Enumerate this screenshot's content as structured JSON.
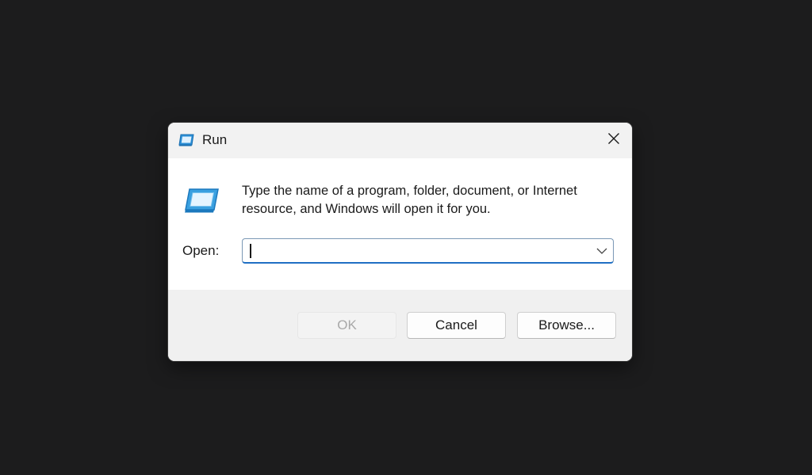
{
  "dialog": {
    "title": "Run",
    "title_icon": "run-app-icon",
    "close_icon": "close-icon"
  },
  "content": {
    "icon": "run-app-icon",
    "message": "Type the name of a program, folder, document, or Internet resource, and Windows will open it for you.",
    "open_label": "Open:",
    "open_value": "",
    "dropdown_icon": "chevron-down-icon"
  },
  "buttons": {
    "ok_label": "OK",
    "cancel_label": "Cancel",
    "browse_label": "Browse..."
  },
  "colors": {
    "background": "#1c1c1d",
    "accent": "#1f6fc4",
    "icon_blue": "#3aa0e0"
  }
}
